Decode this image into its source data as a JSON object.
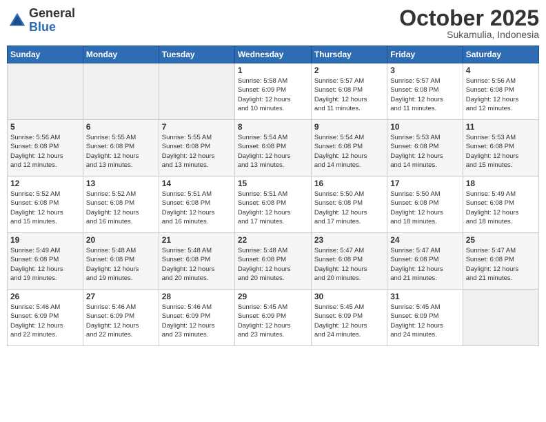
{
  "logo": {
    "general": "General",
    "blue": "Blue"
  },
  "title": "October 2025",
  "subtitle": "Sukamulia, Indonesia",
  "days_of_week": [
    "Sunday",
    "Monday",
    "Tuesday",
    "Wednesday",
    "Thursday",
    "Friday",
    "Saturday"
  ],
  "weeks": [
    [
      {
        "day": "",
        "info": ""
      },
      {
        "day": "",
        "info": ""
      },
      {
        "day": "",
        "info": ""
      },
      {
        "day": "1",
        "info": "Sunrise: 5:58 AM\nSunset: 6:09 PM\nDaylight: 12 hours\nand 10 minutes."
      },
      {
        "day": "2",
        "info": "Sunrise: 5:57 AM\nSunset: 6:08 PM\nDaylight: 12 hours\nand 11 minutes."
      },
      {
        "day": "3",
        "info": "Sunrise: 5:57 AM\nSunset: 6:08 PM\nDaylight: 12 hours\nand 11 minutes."
      },
      {
        "day": "4",
        "info": "Sunrise: 5:56 AM\nSunset: 6:08 PM\nDaylight: 12 hours\nand 12 minutes."
      }
    ],
    [
      {
        "day": "5",
        "info": "Sunrise: 5:56 AM\nSunset: 6:08 PM\nDaylight: 12 hours\nand 12 minutes."
      },
      {
        "day": "6",
        "info": "Sunrise: 5:55 AM\nSunset: 6:08 PM\nDaylight: 12 hours\nand 13 minutes."
      },
      {
        "day": "7",
        "info": "Sunrise: 5:55 AM\nSunset: 6:08 PM\nDaylight: 12 hours\nand 13 minutes."
      },
      {
        "day": "8",
        "info": "Sunrise: 5:54 AM\nSunset: 6:08 PM\nDaylight: 12 hours\nand 13 minutes."
      },
      {
        "day": "9",
        "info": "Sunrise: 5:54 AM\nSunset: 6:08 PM\nDaylight: 12 hours\nand 14 minutes."
      },
      {
        "day": "10",
        "info": "Sunrise: 5:53 AM\nSunset: 6:08 PM\nDaylight: 12 hours\nand 14 minutes."
      },
      {
        "day": "11",
        "info": "Sunrise: 5:53 AM\nSunset: 6:08 PM\nDaylight: 12 hours\nand 15 minutes."
      }
    ],
    [
      {
        "day": "12",
        "info": "Sunrise: 5:52 AM\nSunset: 6:08 PM\nDaylight: 12 hours\nand 15 minutes."
      },
      {
        "day": "13",
        "info": "Sunrise: 5:52 AM\nSunset: 6:08 PM\nDaylight: 12 hours\nand 16 minutes."
      },
      {
        "day": "14",
        "info": "Sunrise: 5:51 AM\nSunset: 6:08 PM\nDaylight: 12 hours\nand 16 minutes."
      },
      {
        "day": "15",
        "info": "Sunrise: 5:51 AM\nSunset: 6:08 PM\nDaylight: 12 hours\nand 17 minutes."
      },
      {
        "day": "16",
        "info": "Sunrise: 5:50 AM\nSunset: 6:08 PM\nDaylight: 12 hours\nand 17 minutes."
      },
      {
        "day": "17",
        "info": "Sunrise: 5:50 AM\nSunset: 6:08 PM\nDaylight: 12 hours\nand 18 minutes."
      },
      {
        "day": "18",
        "info": "Sunrise: 5:49 AM\nSunset: 6:08 PM\nDaylight: 12 hours\nand 18 minutes."
      }
    ],
    [
      {
        "day": "19",
        "info": "Sunrise: 5:49 AM\nSunset: 6:08 PM\nDaylight: 12 hours\nand 19 minutes."
      },
      {
        "day": "20",
        "info": "Sunrise: 5:48 AM\nSunset: 6:08 PM\nDaylight: 12 hours\nand 19 minutes."
      },
      {
        "day": "21",
        "info": "Sunrise: 5:48 AM\nSunset: 6:08 PM\nDaylight: 12 hours\nand 20 minutes."
      },
      {
        "day": "22",
        "info": "Sunrise: 5:48 AM\nSunset: 6:08 PM\nDaylight: 12 hours\nand 20 minutes."
      },
      {
        "day": "23",
        "info": "Sunrise: 5:47 AM\nSunset: 6:08 PM\nDaylight: 12 hours\nand 20 minutes."
      },
      {
        "day": "24",
        "info": "Sunrise: 5:47 AM\nSunset: 6:08 PM\nDaylight: 12 hours\nand 21 minutes."
      },
      {
        "day": "25",
        "info": "Sunrise: 5:47 AM\nSunset: 6:08 PM\nDaylight: 12 hours\nand 21 minutes."
      }
    ],
    [
      {
        "day": "26",
        "info": "Sunrise: 5:46 AM\nSunset: 6:09 PM\nDaylight: 12 hours\nand 22 minutes."
      },
      {
        "day": "27",
        "info": "Sunrise: 5:46 AM\nSunset: 6:09 PM\nDaylight: 12 hours\nand 22 minutes."
      },
      {
        "day": "28",
        "info": "Sunrise: 5:46 AM\nSunset: 6:09 PM\nDaylight: 12 hours\nand 23 minutes."
      },
      {
        "day": "29",
        "info": "Sunrise: 5:45 AM\nSunset: 6:09 PM\nDaylight: 12 hours\nand 23 minutes."
      },
      {
        "day": "30",
        "info": "Sunrise: 5:45 AM\nSunset: 6:09 PM\nDaylight: 12 hours\nand 24 minutes."
      },
      {
        "day": "31",
        "info": "Sunrise: 5:45 AM\nSunset: 6:09 PM\nDaylight: 12 hours\nand 24 minutes."
      },
      {
        "day": "",
        "info": ""
      }
    ]
  ]
}
